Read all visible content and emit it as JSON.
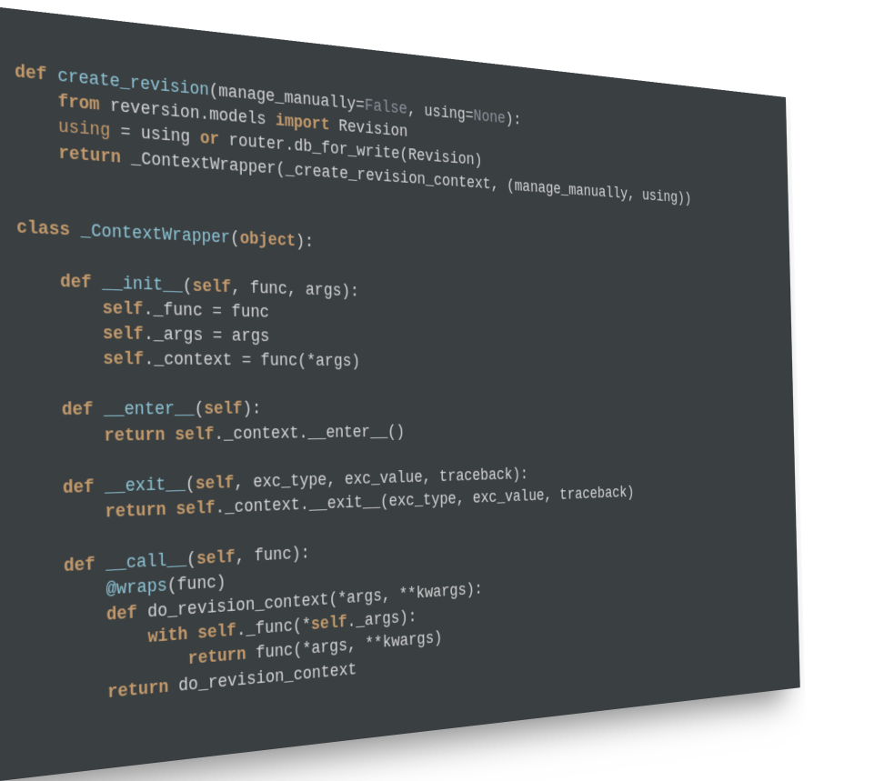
{
  "code": {
    "line1": {
      "kw_def": "def",
      "fn": "create_revision",
      "params_open": "(",
      "p1": "manage_manually",
      "eq1": "=",
      "v1": "False",
      "c1": ", ",
      "p2": "using",
      "eq2": "=",
      "v2": "None",
      "close": "):"
    },
    "line2": {
      "indent": "    ",
      "kw_from": "from",
      "mod": " reversion.models ",
      "kw_import": "import",
      "name": " Revision"
    },
    "line3": {
      "indent": "    ",
      "var": "using",
      "sp1": " = using ",
      "kw_or": "or",
      "rest": " router.db_for_write(Revision)"
    },
    "line4": {
      "indent": "    ",
      "kw_return": "return",
      "rest": " _ContextWrapper(_create_revision_context, (manage_manually, using))"
    },
    "line5": "",
    "line6": "",
    "line7": {
      "kw_class": "class",
      "sp": " ",
      "name": "_ContextWrapper",
      "open": "(",
      "base": "object",
      "close": "):"
    },
    "line8": "",
    "line9": {
      "indent": "    ",
      "kw_def": "def",
      "sp": " ",
      "fn": "__init__",
      "open": "(",
      "self": "self",
      "rest": ", func, args):"
    },
    "line10": {
      "indent": "        ",
      "self": "self",
      "rest": "._func = func"
    },
    "line11": {
      "indent": "        ",
      "self": "self",
      "rest": "._args = args"
    },
    "line12": {
      "indent": "        ",
      "self": "self",
      "rest": "._context = func(*args)"
    },
    "line13": "",
    "line14": {
      "indent": "    ",
      "kw_def": "def",
      "sp": " ",
      "fn": "__enter__",
      "open": "(",
      "self": "self",
      "close": "):"
    },
    "line15": {
      "indent": "        ",
      "kw_return": "return",
      "sp": " ",
      "self": "self",
      "rest": "._context.__enter__()"
    },
    "line16": "",
    "line17": {
      "indent": "    ",
      "kw_def": "def",
      "sp": " ",
      "fn": "__exit__",
      "open": "(",
      "self": "self",
      "rest": ", exc_type, exc_value, traceback):"
    },
    "line18": {
      "indent": "        ",
      "kw_return": "return",
      "sp": " ",
      "self": "self",
      "rest": "._context.__exit__(exc_type, exc_value, traceback)"
    },
    "line19": "",
    "line20": {
      "indent": "    ",
      "kw_def": "def",
      "sp": " ",
      "fn": "__call__",
      "open": "(",
      "self": "self",
      "rest": ", func):"
    },
    "line21": {
      "indent": "        ",
      "deco": "@wraps",
      "rest": "(func)"
    },
    "line22": {
      "indent": "        ",
      "kw_def": "def",
      "sp": " ",
      "fn": "do_revision_context",
      "rest": "(*args, **kwargs):"
    },
    "line23": {
      "indent": "            ",
      "kw_with": "with",
      "sp": " ",
      "self": "self",
      "mid": "._func(*",
      "self2": "self",
      "rest": "._args):"
    },
    "line24": {
      "indent": "                ",
      "kw_return": "return",
      "rest": " func(*args, **kwargs)"
    },
    "line25": {
      "indent": "        ",
      "kw_return": "return",
      "rest": " do_revision_context"
    }
  }
}
